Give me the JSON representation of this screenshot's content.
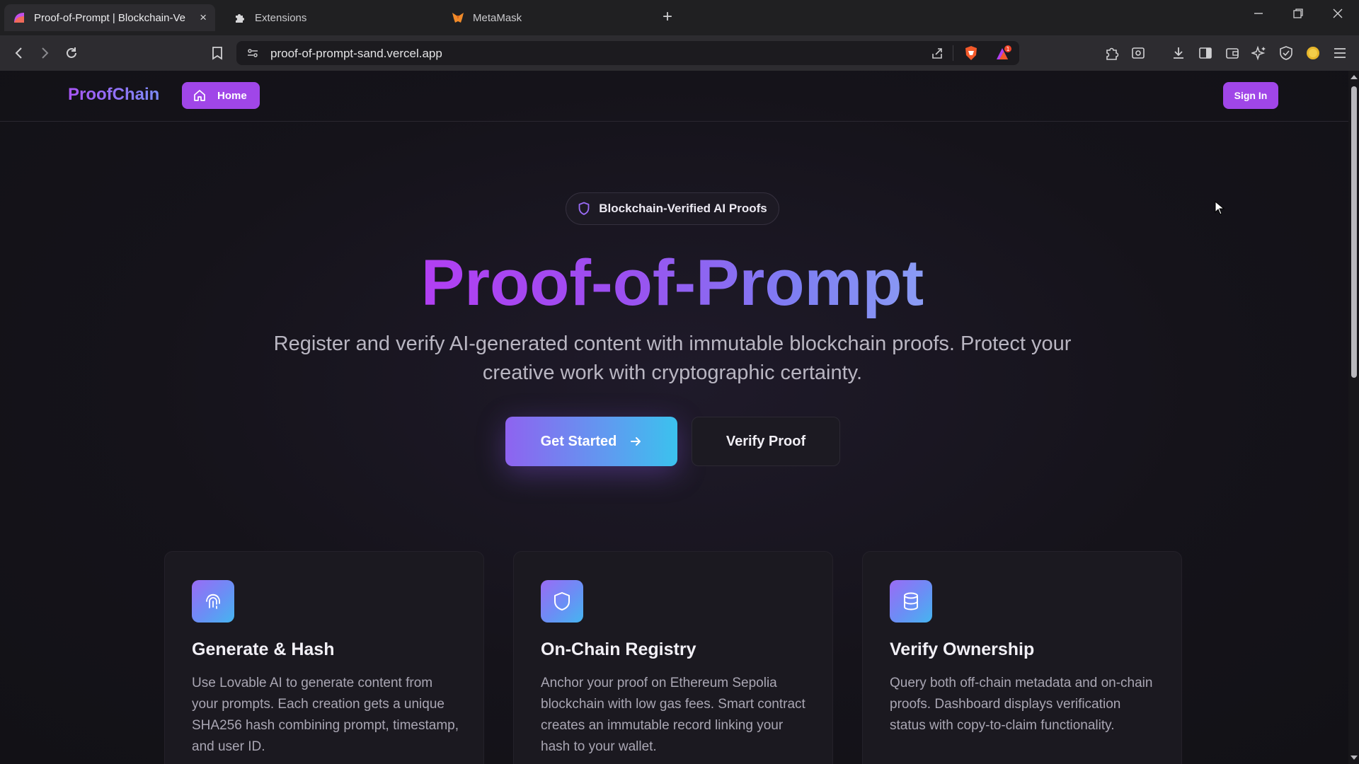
{
  "browser": {
    "tabs": [
      {
        "title": "Proof-of-Prompt | Blockchain-Ve",
        "active": true
      },
      {
        "title": "Extensions",
        "active": false
      },
      {
        "title": "MetaMask",
        "active": false
      }
    ],
    "new_tab": "+",
    "close_tab": "×",
    "url": "proof-of-prompt-sand.vercel.app",
    "notification_count": "1"
  },
  "nav": {
    "brand": "ProofChain",
    "home_label": "Home",
    "sign_in_label": "Sign In"
  },
  "hero": {
    "badge": "Blockchain-Verified AI Proofs",
    "title": "Proof-of-Prompt",
    "subtitle": "Register and verify AI-generated content with immutable blockchain proofs. Protect your creative work with cryptographic certainty.",
    "primary_cta": "Get Started",
    "secondary_cta": "Verify Proof"
  },
  "features": [
    {
      "icon": "fingerprint-icon",
      "title": "Generate & Hash",
      "description": "Use Lovable AI to generate content from your prompts. Each creation gets a unique SHA256 hash combining prompt, timestamp, and user ID."
    },
    {
      "icon": "shield-icon",
      "title": "On-Chain Registry",
      "description": "Anchor your proof on Ethereum Sepolia blockchain with low gas fees. Smart contract creates an immutable record linking your hash to your wallet."
    },
    {
      "icon": "database-icon",
      "title": "Verify Ownership",
      "description": "Query both off-chain metadata and on-chain proofs. Dashboard displays verification status with copy-to-claim functionality."
    }
  ],
  "colors": {
    "accent": "#a046e8",
    "gradient_start": "#8e63f0",
    "gradient_end": "#3bc2ee",
    "background": "#121114"
  }
}
